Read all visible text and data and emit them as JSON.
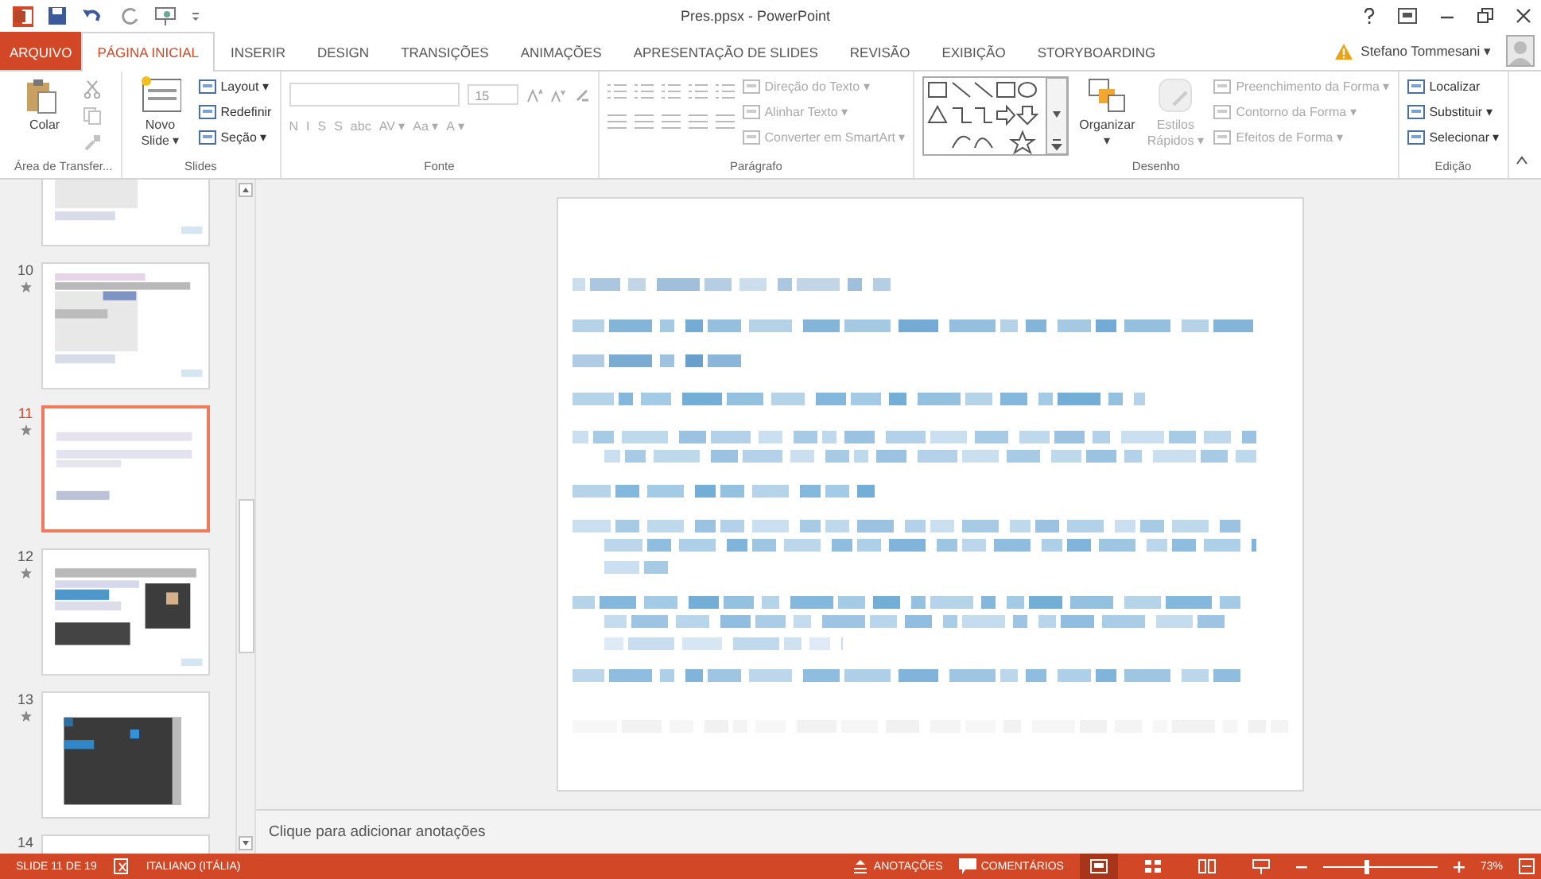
{
  "window": {
    "title": "Pres.ppsx - PowerPoint"
  },
  "tabs": [
    {
      "label": "ARQUIVO",
      "kind": "file",
      "selected": false
    },
    {
      "label": "PÁGINA INICIAL",
      "kind": "tab",
      "selected": true
    },
    {
      "label": "INSERIR",
      "kind": "tab",
      "selected": false
    },
    {
      "label": "DESIGN",
      "kind": "tab",
      "selected": false
    },
    {
      "label": "TRANSIÇÕES",
      "kind": "tab",
      "selected": false
    },
    {
      "label": "ANIMAÇÕES",
      "kind": "tab",
      "selected": false
    },
    {
      "label": "APRESENTAÇÃO DE SLIDES",
      "kind": "tab",
      "selected": false
    },
    {
      "label": "REVISÃO",
      "kind": "tab",
      "selected": false
    },
    {
      "label": "EXIBIÇÃO",
      "kind": "tab",
      "selected": false
    },
    {
      "label": "STORYBOARDING",
      "kind": "tab",
      "selected": false
    }
  ],
  "user": {
    "name": "Stefano Tommesani ▾"
  },
  "ribbon": {
    "groups": [
      {
        "label": "Área de Transfer...",
        "items": [
          {
            "kind": "large",
            "label": "Colar",
            "disabled": false
          },
          {
            "kind": "minis",
            "disabled": true
          }
        ]
      },
      {
        "label": "Slides",
        "items": [
          {
            "kind": "large",
            "label": "Novo Slide ▾",
            "disabled": false
          },
          {
            "kind": "stack",
            "entries": [
              {
                "label": "Layout ▾",
                "disabled": false
              },
              {
                "label": "Redefinir",
                "disabled": false
              },
              {
                "label": "Seção ▾",
                "disabled": false
              }
            ]
          }
        ]
      },
      {
        "label": "Fonte",
        "items": [
          {
            "kind": "font",
            "size": "15",
            "glyphs": [
              "N",
              "I",
              "S",
              "S",
              "abc",
              "AV ▾",
              "Aa ▾",
              "A ▾"
            ],
            "disabled": true
          }
        ]
      },
      {
        "label": "Parágrafo",
        "items": [
          {
            "kind": "para",
            "disabled": true
          },
          {
            "kind": "stack",
            "entries": [
              {
                "label": "Direção do Texto ▾",
                "disabled": true
              },
              {
                "label": "Alinhar Texto ▾",
                "disabled": true
              },
              {
                "label": "Converter em SmartArt ▾",
                "disabled": true
              }
            ]
          }
        ]
      },
      {
        "label": "Desenho",
        "items": [
          {
            "kind": "gallery"
          },
          {
            "kind": "large",
            "label": "Organizar ▾",
            "disabled": false
          },
          {
            "kind": "large",
            "label": "Estilos Rápidos ▾",
            "disabled": true
          },
          {
            "kind": "stack",
            "entries": [
              {
                "label": "Preenchimento da Forma ▾",
                "disabled": true
              },
              {
                "label": "Contorno da Forma ▾",
                "disabled": true
              },
              {
                "label": "Efeitos de Forma ▾",
                "disabled": true
              }
            ]
          }
        ]
      },
      {
        "label": "Edição",
        "items": [
          {
            "kind": "stack",
            "entries": [
              {
                "label": "Localizar",
                "disabled": false
              },
              {
                "label": "Substituir ▾",
                "disabled": false
              },
              {
                "label": "Selecionar ▾",
                "disabled": false
              }
            ]
          }
        ]
      }
    ]
  },
  "thumbnails": [
    {
      "selected": false,
      "kind": "light"
    },
    {
      "number": "10",
      "selected": false,
      "kind": "light"
    },
    {
      "number": "11",
      "selected": true,
      "kind": "text"
    },
    {
      "number": "12",
      "selected": false,
      "kind": "mixed"
    },
    {
      "number": "13",
      "selected": false,
      "kind": "dark"
    },
    {
      "number": "14",
      "selected": false,
      "kind": "text"
    }
  ],
  "notes": {
    "placeholder": "Clique para adicionar anotações"
  },
  "status_bar": {
    "slide": "SLIDE 11 DE 19",
    "language": "ITALIANO (ITÁLIA)",
    "notes": "ANOTAÇÕES",
    "comments": "COMENTÁRIOS",
    "zoom": "73%",
    "zoom_level": {
      "level": 0.38
    },
    "views": [
      {
        "selected": true
      },
      {
        "selected": false
      },
      {
        "selected": false
      },
      {
        "selected": false
      }
    ]
  }
}
